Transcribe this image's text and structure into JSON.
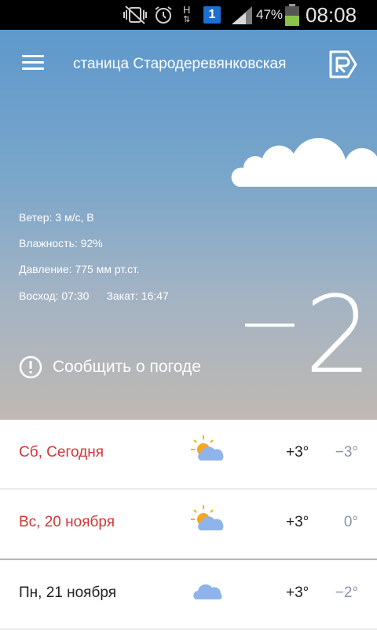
{
  "status_bar": {
    "battery_percent": "47%",
    "time": "08:08",
    "sim_badge": "1",
    "network_label": "H"
  },
  "header": {
    "city": "станица Стародеревянковская"
  },
  "details": {
    "wind": "Ветер: 3 м/с,  В",
    "humidity": "Влажность: 92%",
    "pressure": "Давление: 775 мм рт.ст.",
    "sunrise": "Восход: 07:30",
    "sunset": "Закат: 16:47"
  },
  "report_label": "Сообщить о погоде",
  "current_temp": {
    "sign": "−",
    "value": "2"
  },
  "forecast": [
    {
      "day": "Сб, Сегодня",
      "high": "+3°",
      "low": "−3°",
      "icon": "partly-cloudy-icon"
    },
    {
      "day": "Вс, 20 ноября",
      "high": "+3°",
      "low": "0°",
      "icon": "partly-cloudy-icon"
    },
    {
      "day": "Пн, 21 ноября",
      "high": "+3°",
      "low": "−2°",
      "icon": "cloud-icon"
    }
  ],
  "colors": {
    "weekend_day": "#d43535",
    "weekday": "#222222",
    "low_temp": "#8a93ac",
    "sky_top": "#5e98cc",
    "sky_bottom": "#bfb9b3"
  }
}
